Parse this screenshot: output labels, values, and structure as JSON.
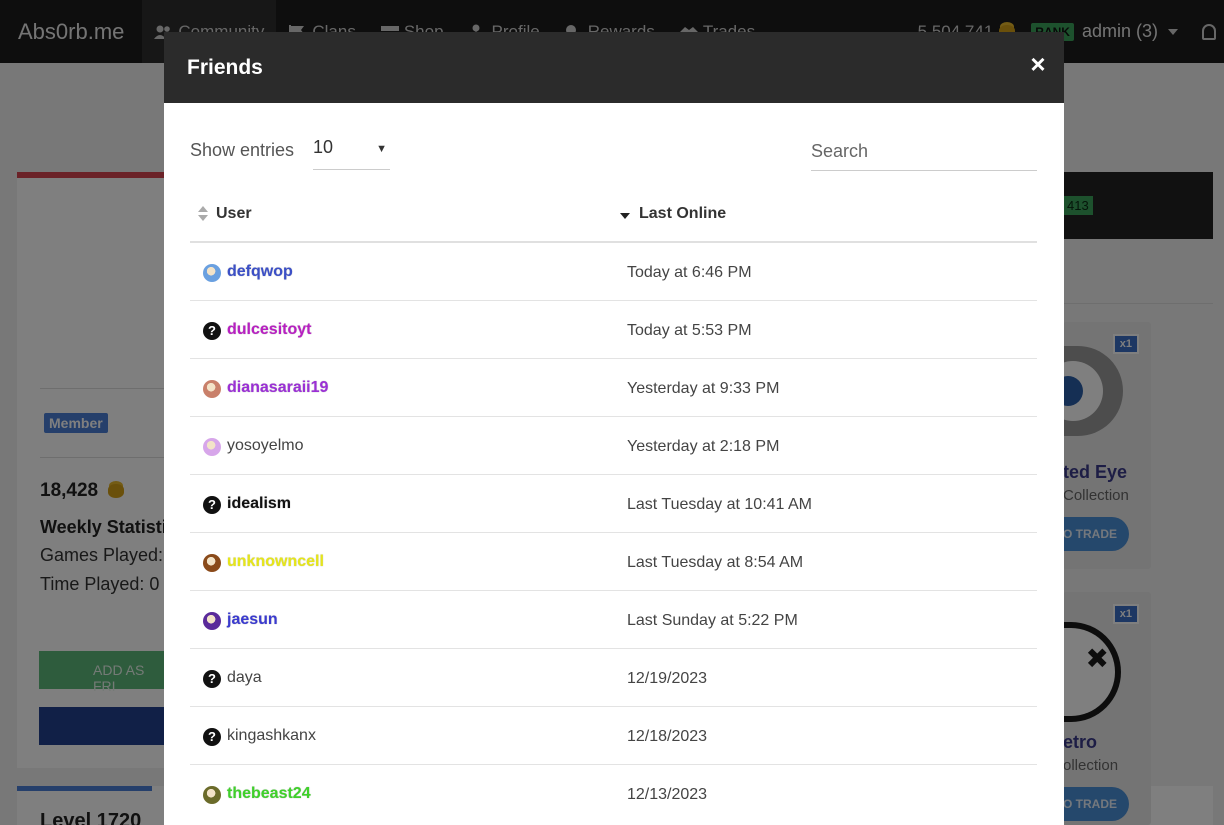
{
  "navbar": {
    "brand": "Abs0rb.me",
    "items": [
      {
        "label": "Community",
        "icon": "users-icon",
        "active": true
      },
      {
        "label": "Clans",
        "icon": "flag-icon"
      },
      {
        "label": "Shop",
        "icon": "store-icon"
      },
      {
        "label": "Profile",
        "icon": "user-icon"
      },
      {
        "label": "Rewards",
        "icon": "medal-icon"
      },
      {
        "label": "Trades",
        "icon": "handshake-icon"
      }
    ],
    "coins": "5,504,741",
    "rank": "RANK",
    "user": "admin (3)"
  },
  "background": {
    "member_badge": "Member",
    "coins": "18,428",
    "weekly_title": "Weekly Statisti",
    "games_played": "Games Played:",
    "time_played": "Time Played: 0",
    "add_friend": "ADD AS FRI",
    "level": "Level 1720",
    "badge": "413",
    "cards": [
      {
        "name": "ted Eye",
        "collection": "Collection",
        "trade": "O TRADE",
        "qty": "x1"
      },
      {
        "name": "etro",
        "collection": "ollection",
        "trade": "O TRADE",
        "qty": "x1"
      }
    ]
  },
  "modal": {
    "title": "Friends",
    "close": "×",
    "show_entries_label": "Show entries",
    "entries_value": "10",
    "search_placeholder": "Search",
    "columns": {
      "user": "User",
      "last_online": "Last Online"
    },
    "rows": [
      {
        "user": "defqwop",
        "last_online": "Today at 6:46 PM",
        "color": "#3b4fc7",
        "styled": true,
        "avatar": "#6aa0e0"
      },
      {
        "user": "dulcesitoyt",
        "last_online": "Today at 5:53 PM",
        "color": "#b81fc2",
        "styled": true,
        "avatar": "unknown"
      },
      {
        "user": "dianasaraii19",
        "last_online": "Yesterday at 9:33 PM",
        "color": "#9b2fd6",
        "styled": true,
        "avatar": "#c9806a"
      },
      {
        "user": "yosoyelmo",
        "last_online": "Yesterday at 2:18 PM",
        "color": "#444444",
        "styled": false,
        "avatar": "#d7a6ea"
      },
      {
        "user": "idealism",
        "last_online": "Last Tuesday at 10:41 AM",
        "color": "#111111",
        "styled": true,
        "avatar": "unknown"
      },
      {
        "user": "unknowncell",
        "last_online": "Last Tuesday at 8:54 AM",
        "color": "#e6e61a",
        "styled": true,
        "avatar": "#8a4a1a"
      },
      {
        "user": "jaesun",
        "last_online": "Last Sunday at 5:22 PM",
        "color": "#3a3ad0",
        "styled": true,
        "avatar": "#5a2a9a"
      },
      {
        "user": "daya",
        "last_online": "12/19/2023",
        "color": "#444444",
        "styled": false,
        "avatar": "unknown"
      },
      {
        "user": "kingashkanx",
        "last_online": "12/18/2023",
        "color": "#444444",
        "styled": false,
        "avatar": "unknown"
      },
      {
        "user": "thebeast24",
        "last_online": "12/13/2023",
        "color": "#3fd12a",
        "styled": true,
        "avatar": "#6b6b2a"
      }
    ]
  }
}
